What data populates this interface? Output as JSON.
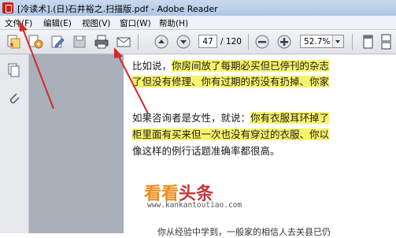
{
  "window": {
    "title": "[冷读术].(日)石井裕之.扫描版.pdf - Adobe Reader"
  },
  "menu": [
    "文件(F)",
    "编辑(E)",
    "视图(V)",
    "窗口(W)",
    "帮助(H)"
  ],
  "toolbar": {
    "page_current": "47",
    "page_total": "/ 120",
    "zoom": "52.7%",
    "icons": [
      "create-pdf-icon",
      "collaborate-icon",
      "edit-icon",
      "save-icon",
      "print-icon",
      "email-icon",
      "previous-page-icon",
      "next-page-icon",
      "zoom-out-icon",
      "zoom-in-icon",
      "single-page-view-icon",
      "continuous-view-icon"
    ]
  },
  "sidebar": {
    "icons": [
      "pages-icon",
      "attachments-icon"
    ]
  },
  "document": {
    "p1_line1_plain": "比如说，",
    "p1_line1_highlight": "你房间放了每期必买但已停刊的杂志",
    "p1_line2_highlight": "了但没有修理、你有过期的药没有扔掉、你家",
    "p2_line1_plain": "如果咨询者是女性，就说：",
    "p2_line1_highlight": "你有衣服耳环掉了",
    "p2_line2_highlight": "柜里面有买来但一次也没有穿过的衣服、你以",
    "p2_line3_plain": "像这样的例行话题准确率都很高。",
    "bottom_text": "你从经验中学到，一般家的相信人去关县已仍"
  },
  "watermark": {
    "part1": "看看",
    "part2": "头条",
    "url": "www.kankantoutiao.com"
  },
  "colors": {
    "highlight": "#f7f36b",
    "annotation_arrow": "#d8262b",
    "watermark_orange": "#f08a1c",
    "watermark_red": "#c4373a"
  }
}
